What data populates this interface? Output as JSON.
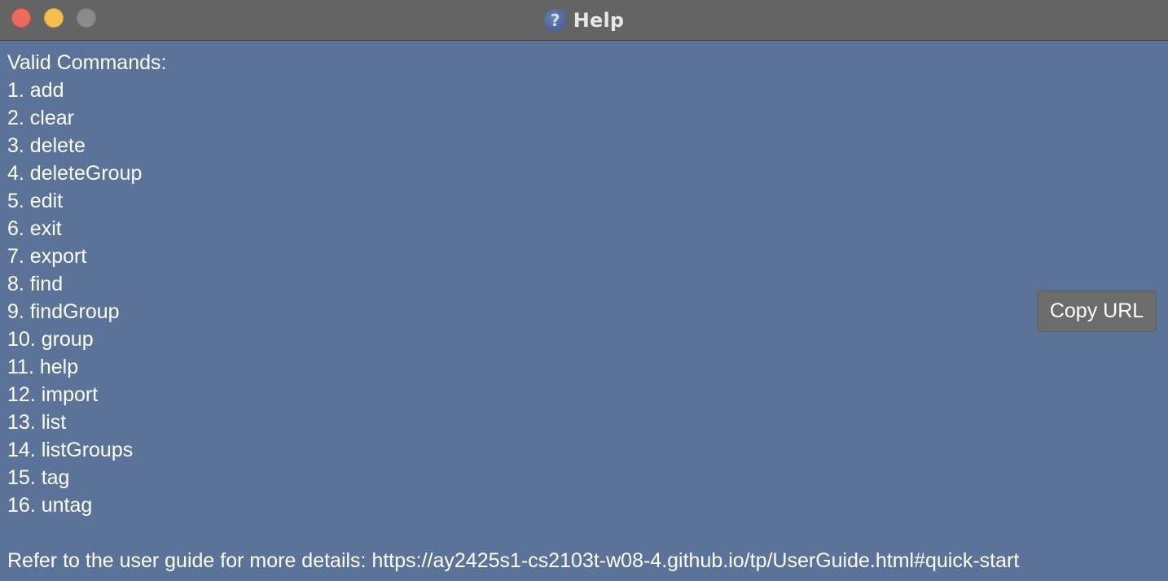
{
  "window": {
    "title": "Help",
    "icon": "question-mark-icon"
  },
  "help": {
    "heading": "Valid Commands:",
    "commands": [
      "1. add",
      "2. clear",
      "3. delete",
      "4. deleteGroup",
      "5. edit",
      "6. exit",
      "7. export",
      "8. find",
      "9. findGroup",
      "10. group",
      "11. help",
      "12. import",
      "13. list",
      "14. listGroups",
      "15. tag",
      "16. untag"
    ],
    "footer": "Refer to the user guide for more details: https://ay2425s1-cs2103t-w08-4.github.io/tp/UserGuide.html#quick-start",
    "copy_button_label": "Copy URL"
  },
  "colors": {
    "background": "#5b7399",
    "titlebar": "#646464",
    "button": "#6c6c6c",
    "close": "#ed6a5e",
    "minimize": "#f4bf4f",
    "maximize": "#8a8a8a"
  }
}
